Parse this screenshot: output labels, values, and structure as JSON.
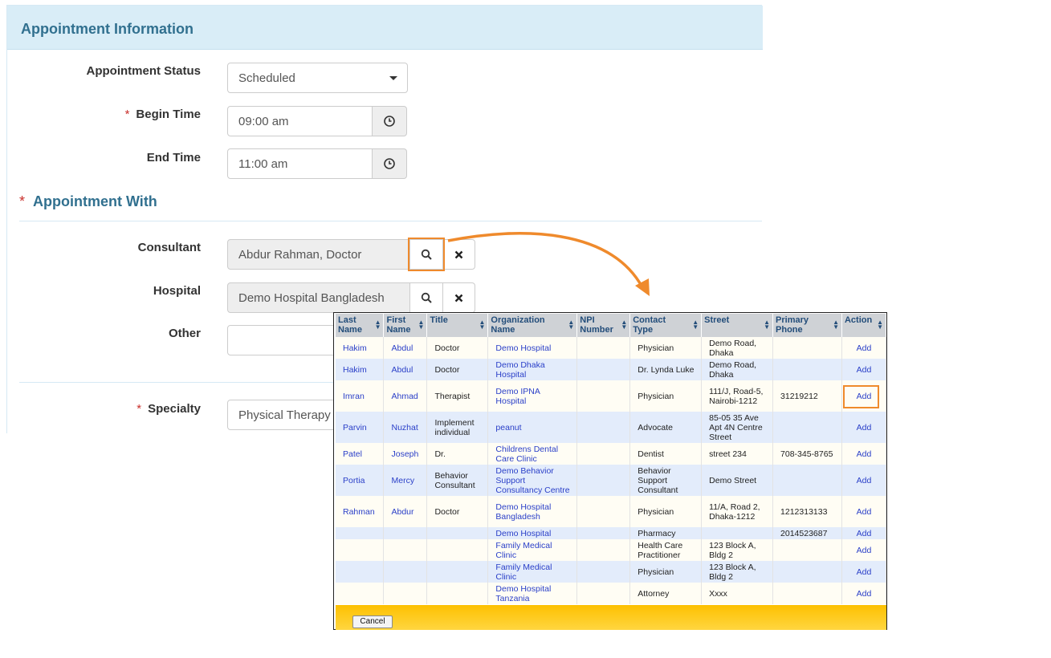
{
  "panel": {
    "title": "Appointment Information"
  },
  "form": {
    "status": {
      "label": "Appointment Status",
      "value": "Scheduled"
    },
    "begin": {
      "label": "Begin Time",
      "value": "09:00 am"
    },
    "end": {
      "label": "End Time",
      "value": "11:00 am"
    },
    "with_title": "Appointment With",
    "required_mark": "*",
    "consultant": {
      "label": "Consultant",
      "value": "Abdur Rahman, Doctor"
    },
    "hospital": {
      "label": "Hospital",
      "value": "Demo Hospital Bangladesh"
    },
    "other": {
      "label": "Other",
      "value": ""
    },
    "specialty": {
      "label": "Specialty",
      "value": "Physical Therapy"
    }
  },
  "icons": {
    "clock": "clock-icon",
    "search": "search-icon",
    "clear": "close-icon",
    "dropdown": "caret-down-icon",
    "sort": "sort-icon"
  },
  "colors": {
    "header_bg": "#d9edf7",
    "title": "#31708f",
    "highlight": "#ef8a2c",
    "footer": "#ffc400",
    "link": "#2a3fc8"
  },
  "lookup": {
    "columns": [
      {
        "line1": "Last",
        "line2": "Name"
      },
      {
        "line1": "First",
        "line2": "Name"
      },
      {
        "line1": "Title",
        "line2": ""
      },
      {
        "line1": "Organization",
        "line2": "Name"
      },
      {
        "line1": "NPI",
        "line2": "Number"
      },
      {
        "line1": "Contact",
        "line2": "Type"
      },
      {
        "line1": "Street",
        "line2": ""
      },
      {
        "line1": "Primary",
        "line2": "Phone"
      },
      {
        "line1": "Action",
        "line2": ""
      }
    ],
    "rows": [
      {
        "last": "Hakim",
        "first": "Abdul",
        "title": "Doctor",
        "org": "Demo Hospital",
        "npi": "",
        "type": "Physician",
        "street": "Demo Road, Dhaka",
        "phone": "",
        "action": "Add"
      },
      {
        "last": "Hakim",
        "first": "Abdul",
        "title": "Doctor",
        "org": "Demo Dhaka Hospital",
        "npi": "",
        "type": "Dr. Lynda Luke",
        "street": "Demo Road, Dhaka",
        "phone": "",
        "action": "Add"
      },
      {
        "last": "Imran",
        "first": "Ahmad",
        "title": "Therapist",
        "org": "Demo IPNA Hospital",
        "npi": "",
        "type": "Physician",
        "street": "111/J, Road-5, Nairobi-1212",
        "phone": "31219212",
        "action": "Add"
      },
      {
        "last": "Parvin",
        "first": "Nuzhat",
        "title": "Implement individual",
        "org": "peanut",
        "npi": "",
        "type": "Advocate",
        "street": "85-05 35 Ave Apt 4N Centre Street",
        "phone": "",
        "action": "Add"
      },
      {
        "last": "Patel",
        "first": "Joseph",
        "title": "Dr.",
        "org": "Childrens Dental Care Clinic",
        "npi": "",
        "type": "Dentist",
        "street": "street 234",
        "phone": "708-345-8765",
        "action": "Add"
      },
      {
        "last": "Portia",
        "first": "Mercy",
        "title": "Behavior Consultant",
        "org": "Demo Behavior Support Consultancy Centre",
        "npi": "",
        "type": "Behavior Support Consultant",
        "street": "Demo Street",
        "phone": "",
        "action": "Add"
      },
      {
        "last": "Rahman",
        "first": "Abdur",
        "title": "Doctor",
        "org": "Demo Hospital Bangladesh",
        "npi": "",
        "type": "Physician",
        "street": "11/A, Road 2, Dhaka-1212",
        "phone": "1212313133",
        "action": "Add"
      },
      {
        "last": "",
        "first": "",
        "title": "",
        "org": "Demo Hospital",
        "npi": "",
        "type": "Pharmacy",
        "street": "",
        "phone": "2014523687",
        "action": "Add"
      },
      {
        "last": "",
        "first": "",
        "title": "",
        "org": "Family Medical Clinic",
        "npi": "",
        "type": "Health Care Practitioner",
        "street": "123 Block A, Bldg 2",
        "phone": "",
        "action": "Add"
      },
      {
        "last": "",
        "first": "",
        "title": "",
        "org": "Family Medical Clinic",
        "npi": "",
        "type": "Physician",
        "street": "123 Block A, Bldg 2",
        "phone": "",
        "action": "Add"
      },
      {
        "last": "",
        "first": "",
        "title": "",
        "org": "Demo Hospital Tanzania",
        "npi": "",
        "type": "Attorney",
        "street": "Xxxx",
        "phone": "",
        "action": "Add"
      }
    ],
    "cancel_label": "Cancel"
  }
}
